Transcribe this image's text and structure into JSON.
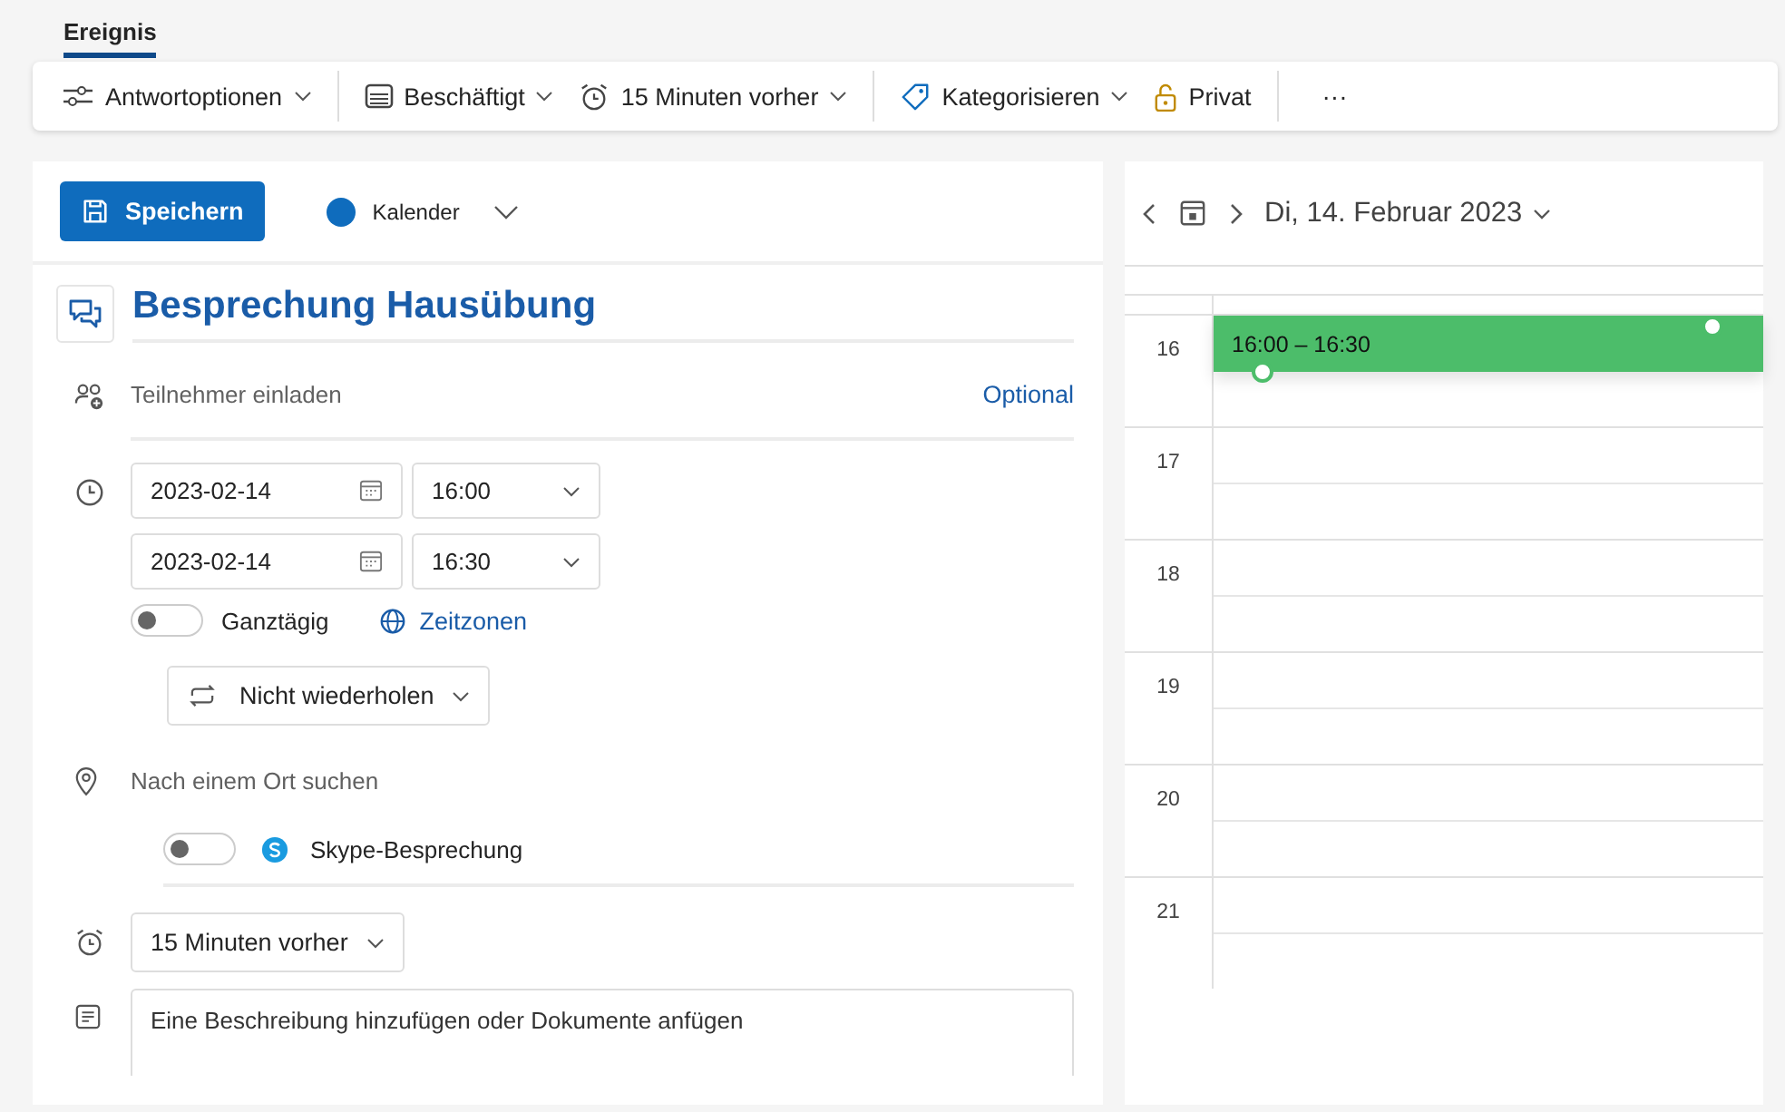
{
  "tabs": [
    {
      "label": "Ereignis",
      "selected": true
    }
  ],
  "toolbar": [
    {
      "kind": "dropdown",
      "label": "Antwortoptionen",
      "group_end": true
    },
    {
      "kind": "dropdown",
      "label": "Beschäftigt",
      "group_end": false
    },
    {
      "kind": "dropdown",
      "label": "15 Minuten vorher",
      "group_end": true
    },
    {
      "kind": "dropdown",
      "label": "Kategorisieren",
      "group_end": false
    },
    {
      "kind": "button",
      "label": "Privat",
      "group_end": true
    },
    {
      "kind": "more",
      "label": "···",
      "group_end": false
    }
  ],
  "form": {
    "save_button": "Speichern",
    "calendar_picker": {
      "label": "Kalender",
      "color": "#0f6cbd"
    },
    "title": "Besprechung Hausübung",
    "attendees": {
      "placeholder": "Teilnehmer einladen",
      "optional_link": "Optional"
    },
    "start": {
      "date": "2023-02-14",
      "time": "16:00"
    },
    "end": {
      "date": "2023-02-14",
      "time": "16:30"
    },
    "all_day": {
      "label": "Ganztägig",
      "on": false
    },
    "timezones_link": "Zeitzonen",
    "repeat": "Nicht wiederholen",
    "location": {
      "placeholder": "Nach einem Ort suchen"
    },
    "online_meeting": {
      "label": "Skype-Besprechung",
      "on": false
    },
    "reminder": "15 Minuten vorher",
    "description": {
      "placeholder": "Eine Beschreibung hinzufügen oder Dokumente anfügen"
    }
  },
  "calendar": {
    "date_label": "Di, 14. Februar 2023",
    "hours": [
      "16",
      "17",
      "18",
      "19",
      "20",
      "21"
    ],
    "event": {
      "time": "16:00 – 16:30",
      "color": "#4cbd6a"
    }
  }
}
